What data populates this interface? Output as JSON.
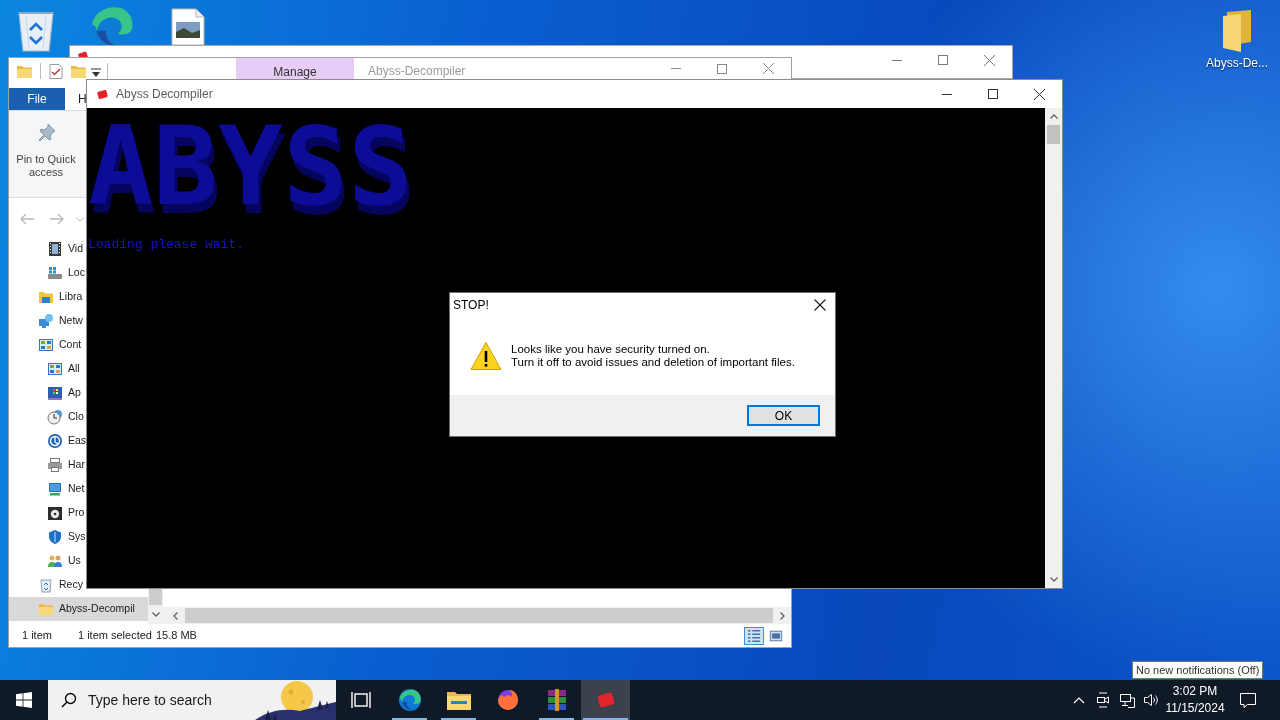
{
  "desktop": {
    "icons": [
      {
        "kind": "recycle-bin"
      },
      {
        "kind": "browser"
      },
      {
        "kind": "image-file"
      },
      {
        "kind": "folder",
        "label": "Abyss-De..."
      }
    ]
  },
  "explorer": {
    "title": "Abyss-Decompiler",
    "contextual_tab": "Manage",
    "ribbon_tabs": [
      {
        "label": "File",
        "kind": "file"
      },
      {
        "label": "H",
        "kind": "tab"
      }
    ],
    "ribbon_buttons": [
      {
        "label": "Pin to Quick access"
      }
    ],
    "sidebar": {
      "items": [
        {
          "children": [
            {
              "label": "Vid",
              "kind": "videos",
              "selected": false
            },
            {
              "label": "Loc",
              "kind": "drive",
              "selected": false
            }
          ]
        },
        {
          "label": "Libra",
          "kind": "libraries",
          "selected": false
        },
        {
          "label": "Netw",
          "kind": "network",
          "selected": false
        },
        {
          "label": "Cont",
          "kind": "control-panel",
          "selected": false,
          "children": [
            {
              "label": "All",
              "kind": "control-panel",
              "selected": false
            },
            {
              "label": "Ap",
              "kind": "programs",
              "selected": false
            },
            {
              "label": "Clo",
              "kind": "clock",
              "selected": false
            },
            {
              "label": "Eas",
              "kind": "ease",
              "selected": false
            },
            {
              "label": "Har",
              "kind": "hardware",
              "selected": false
            },
            {
              "label": "Net",
              "kind": "network-center",
              "selected": false
            },
            {
              "label": "Pro",
              "kind": "program",
              "selected": false
            },
            {
              "label": "Sys",
              "kind": "system",
              "selected": false
            },
            {
              "label": "Us",
              "kind": "users",
              "selected": false
            }
          ]
        },
        {
          "label": "Recy",
          "kind": "recycle-bin",
          "selected": false
        },
        {
          "label": "Abyss-Decompil",
          "kind": "folder",
          "selected": true
        }
      ]
    },
    "status_bar": {
      "item_count": "1 item",
      "selection": "1 item selected",
      "size": "15.8 MB",
      "views": [
        {
          "kind": "details",
          "selected": true
        },
        {
          "kind": "large-icons",
          "selected": false
        }
      ]
    }
  },
  "console": {
    "title": "Abyss Decompiler",
    "banner": "ABYSS",
    "lines": [
      "Loading please wait."
    ]
  },
  "dialog": {
    "title": "STOP!",
    "message": [
      "Looks like you have security turned on.",
      "Turn it off to avoid issues and deletion of important files."
    ],
    "buttons": [
      {
        "label": "OK",
        "default": true
      }
    ]
  },
  "taskbar": {
    "search": {
      "placeholder": "Type here to search"
    },
    "apps": [
      {
        "kind": "task-view",
        "running": false,
        "selected": false
      },
      {
        "kind": "browser",
        "running": true,
        "selected": false
      },
      {
        "kind": "file-manager",
        "running": true,
        "selected": false
      },
      {
        "kind": "fox-browser",
        "running": false,
        "selected": false
      },
      {
        "kind": "archiver",
        "running": true,
        "selected": false
      },
      {
        "kind": "app",
        "running": true,
        "selected": true
      }
    ],
    "clock": {
      "time": "3:02 PM",
      "date": "11/15/2024"
    },
    "tooltip": "No new notifications (Off)"
  }
}
